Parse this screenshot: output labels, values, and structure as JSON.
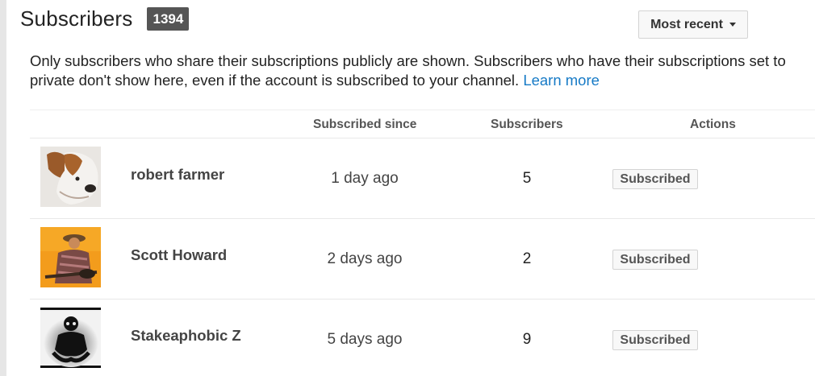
{
  "header": {
    "title": "Subscribers",
    "count": "1394",
    "sort_label": "Most recent"
  },
  "notice": {
    "text": "Only subscribers who share their subscriptions publicly are shown. Subscribers who have their subscriptions set to private don't show here, even if the account is subscribed to your channel.",
    "link": "Learn more"
  },
  "table": {
    "columns": {
      "since": "Subscribed since",
      "subscribers": "Subscribers",
      "actions": "Actions"
    },
    "rows": [
      {
        "name": "robert farmer",
        "since": "1 day ago",
        "subscribers": "5",
        "action": "Subscribed",
        "avatar": "dog-avatar"
      },
      {
        "name": "Scott Howard",
        "since": "2 days ago",
        "subscribers": "2",
        "action": "Subscribed",
        "avatar": "guitarist-avatar"
      },
      {
        "name": "Stakeaphobic Z",
        "since": "5 days ago",
        "subscribers": "9",
        "action": "Subscribed",
        "avatar": "silhouette-avatar"
      }
    ]
  },
  "colors": {
    "link": "#167ac6",
    "badge": "#555555"
  }
}
